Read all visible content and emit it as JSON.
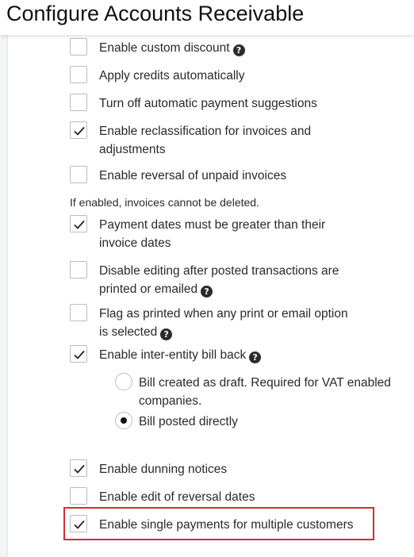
{
  "header": {
    "title": "Configure Accounts Receivable"
  },
  "options": [
    {
      "label": "Enable custom discount",
      "checked": false,
      "help": true
    },
    {
      "label": "Apply credits automatically",
      "checked": false,
      "help": false
    },
    {
      "label": "Turn off automatic payment suggestions",
      "checked": false,
      "help": false
    },
    {
      "label": "Enable reclassification for invoices and",
      "label2": "adjustments",
      "checked": true,
      "help": false
    },
    {
      "label": "Enable reversal of unpaid invoices",
      "checked": false,
      "help": false
    },
    {
      "label": "Payment dates must be greater than their",
      "label2": "invoice dates",
      "checked": true,
      "help": false
    },
    {
      "label": "Disable editing after posted transactions are",
      "label2": "printed or emailed",
      "checked": false,
      "help": true
    },
    {
      "label": "Flag as printed when any print or email option",
      "label2": "is selected",
      "checked": false,
      "help": true
    },
    {
      "label": "Enable inter-entity bill back",
      "checked": true,
      "help": true
    },
    {
      "label": "Enable dunning notices",
      "checked": true,
      "help": false
    },
    {
      "label": "Enable edit of reversal dates",
      "checked": false,
      "help": false
    },
    {
      "label": "Enable single payments for multiple customers",
      "checked": true,
      "help": false,
      "highlighted": true
    }
  ],
  "reversal_note": "If enabled, invoices cannot be deleted.",
  "bill_back_options": [
    {
      "label": "Bill created as draft. Required for VAT enabled",
      "label2": "companies.",
      "selected": false
    },
    {
      "label": "Bill posted directly",
      "selected": true
    }
  ],
  "help_glyph": "?"
}
